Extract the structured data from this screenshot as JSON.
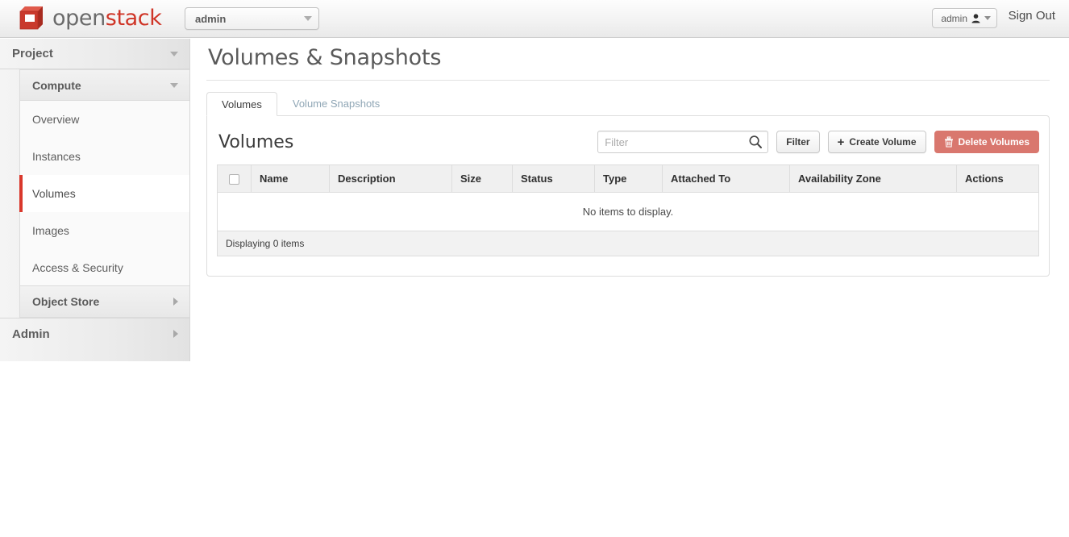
{
  "header": {
    "brand_open": "open",
    "brand_stack": "stack",
    "logo_icon": "openstack-cube-icon",
    "tenant_value": "admin",
    "tenant_caret_icon": "chevron-down-icon",
    "user_value": "admin",
    "user_icon": "user-silhouette-icon",
    "user_caret_icon": "chevron-down-icon",
    "signout_label": "Sign Out"
  },
  "sidebar": {
    "project_label": "Project",
    "project_caret_icon": "chevron-down-icon",
    "compute_label": "Compute",
    "compute_caret_icon": "chevron-down-icon",
    "items": [
      {
        "label": "Overview",
        "active": false
      },
      {
        "label": "Instances",
        "active": false
      },
      {
        "label": "Volumes",
        "active": true
      },
      {
        "label": "Images",
        "active": false
      },
      {
        "label": "Access & Security",
        "active": false
      }
    ],
    "object_store_label": "Object Store",
    "object_store_caret_icon": "chevron-right-icon",
    "admin_label": "Admin",
    "admin_caret_icon": "chevron-right-icon"
  },
  "main": {
    "page_title": "Volumes & Snapshots",
    "tabs": [
      {
        "label": "Volumes",
        "active": true
      },
      {
        "label": "Volume Snapshots",
        "active": false
      }
    ],
    "table_title": "Volumes",
    "filter_placeholder": "Filter",
    "filter_value": "",
    "search_icon": "search-icon",
    "filter_button_label": "Filter",
    "create_button_label": "Create Volume",
    "create_button_icon": "plus-icon",
    "delete_button_label": "Delete Volumes",
    "delete_button_icon": "trash-icon",
    "columns": [
      "Name",
      "Description",
      "Size",
      "Status",
      "Type",
      "Attached To",
      "Availability Zone",
      "Actions"
    ],
    "empty_message": "No items to display.",
    "footer_text": "Displaying 0 items"
  },
  "colors": {
    "brand_red": "#cf3527",
    "accent_red": "#d9382c",
    "danger_bg": "#d9776e",
    "tab_inactive": "#8fa6b5"
  }
}
